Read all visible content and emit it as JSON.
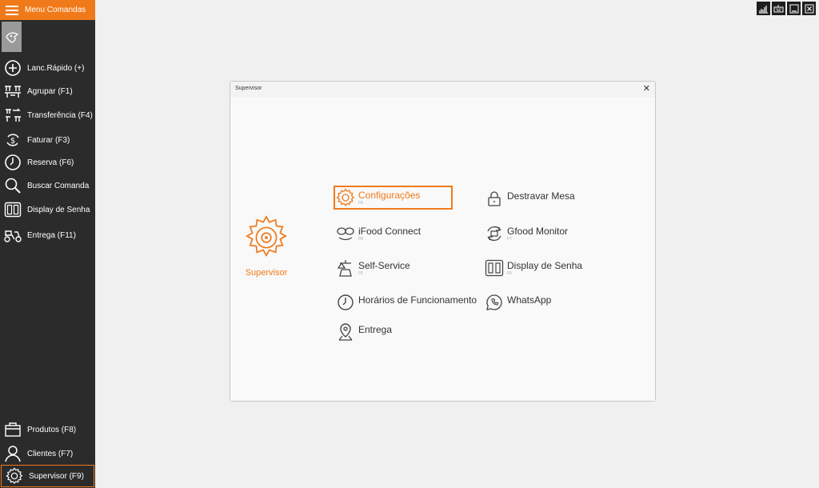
{
  "menu": {
    "title": "Menu Comandas"
  },
  "sidebar": {
    "items": [
      {
        "label": "Lanc.Rápido (+)",
        "icon": "plus-circle-icon"
      },
      {
        "label": "Agrupar (F1)",
        "icon": "tables-icon"
      },
      {
        "label": "Transferência (F4)",
        "icon": "transfer-icon"
      },
      {
        "label": "Faturar (F3)",
        "icon": "money-icon"
      },
      {
        "label": "Reserva (F6)",
        "icon": "clock-icon"
      },
      {
        "label": "Buscar Comanda",
        "icon": "search-icon"
      },
      {
        "label": "Display de Senha",
        "icon": "display-icon"
      },
      {
        "label": "Entrega (F11)",
        "icon": "scooter-icon"
      }
    ],
    "bottom_items": [
      {
        "label": "Produtos (F8)",
        "icon": "products-icon"
      },
      {
        "label": "Clientes (F7)",
        "icon": "user-icon"
      },
      {
        "label": "Supervisor (F9)",
        "icon": "gear-icon"
      }
    ]
  },
  "dialog": {
    "title": "Supervisor",
    "close": "✕",
    "section_label": "Supervisor",
    "options_left": [
      {
        "label": "Configurações",
        "sub": "F8",
        "icon": "gear-icon"
      },
      {
        "label": "iFood Connect",
        "sub": "F8",
        "icon": "ifood-icon"
      },
      {
        "label": "Self-Service",
        "sub": "F6",
        "icon": "scale-icon"
      },
      {
        "label": "Horários de Funcionamento",
        "sub": "",
        "icon": "clock-icon"
      },
      {
        "label": "Entrega",
        "sub": "",
        "icon": "map-pin-icon"
      }
    ],
    "options_right": [
      {
        "label": "Destravar Mesa",
        "sub": "",
        "icon": "lock-icon"
      },
      {
        "label": "Gfood Monitor",
        "sub": "F7",
        "icon": "printer-refresh-icon"
      },
      {
        "label": "Display de Senha",
        "sub": "F5",
        "icon": "display-icon"
      },
      {
        "label": "WhatsApp",
        "sub": "",
        "icon": "whatsapp-icon"
      }
    ]
  },
  "colors": {
    "accent": "#f07a1a",
    "sidebar": "#2b2b2b"
  }
}
